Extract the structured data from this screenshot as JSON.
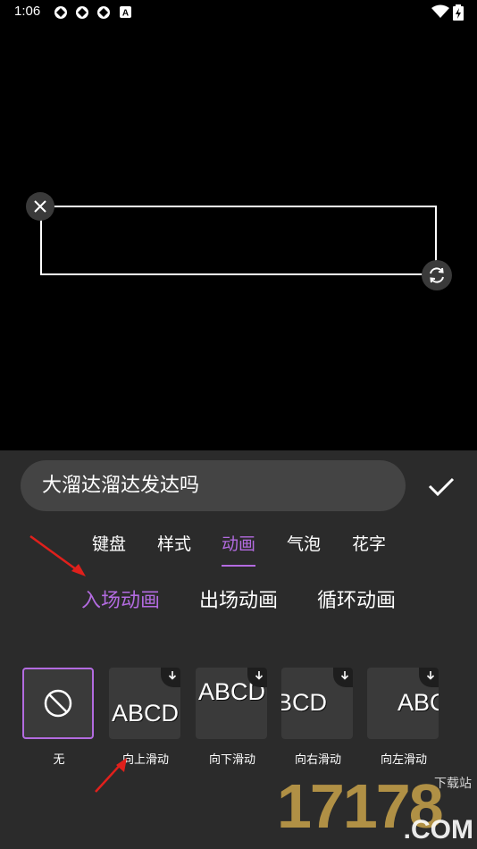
{
  "status_bar": {
    "time": "1:06"
  },
  "editor": {
    "text_value": "大溜达溜达发达吗"
  },
  "tabs": [
    {
      "label": "键盘"
    },
    {
      "label": "样式"
    },
    {
      "label": "动画"
    },
    {
      "label": "气泡"
    },
    {
      "label": "花字"
    }
  ],
  "active_tab": "动画",
  "subtabs": [
    {
      "label": "入场动画"
    },
    {
      "label": "出场动画"
    },
    {
      "label": "循环动画"
    }
  ],
  "active_subtab": "入场动画",
  "effects": [
    {
      "label": "无",
      "thumb_text": ""
    },
    {
      "label": "向上滑动",
      "thumb_text": "ABCD"
    },
    {
      "label": "向下滑动",
      "thumb_text": "ABCD"
    },
    {
      "label": "向右滑动",
      "thumb_text": "BCD"
    },
    {
      "label": "向左滑动",
      "thumb_text": "ABC"
    }
  ],
  "selected_effect": "无",
  "watermark": {
    "number": "17178",
    "cn": "下载站",
    "com": ".COM"
  },
  "colors": {
    "accent": "#b36be0",
    "panel": "#2b2b2b",
    "arrow": "#e0201c"
  }
}
